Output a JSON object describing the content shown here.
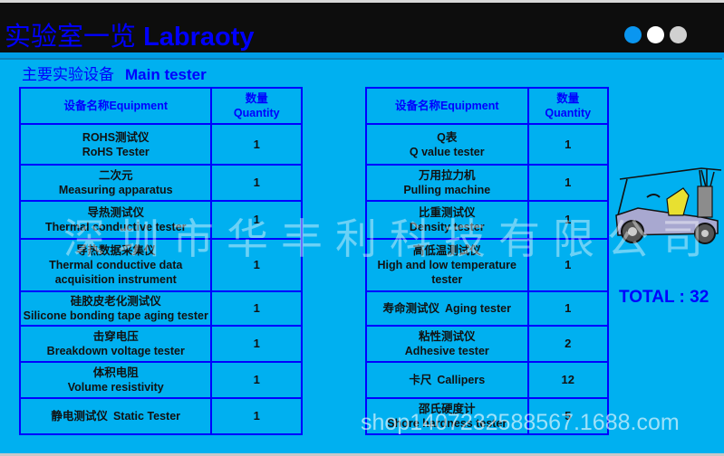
{
  "header": {
    "title_cn": "实验室一览",
    "title_en": "Labraoty",
    "dots": [
      "active",
      "inactive",
      "inactive"
    ]
  },
  "subtitle": {
    "cn": "主要实验设备",
    "en": "Main tester"
  },
  "table_headers": {
    "equipment": "设备名称Equipment",
    "quantity_cn": "数量",
    "quantity_en": "Quantity"
  },
  "left_table": [
    {
      "cn": "ROHS测试仪",
      "en": "RoHS Tester",
      "qty": "1"
    },
    {
      "cn": "二次元",
      "en": "Measuring apparatus",
      "qty": "1"
    },
    {
      "cn": "导热测试仪",
      "en": "Thermal conductive tester",
      "qty": "1"
    },
    {
      "cn": "导热数据采集仪",
      "en": "Thermal conductive data acquisition instrument",
      "qty": "1"
    },
    {
      "cn": "硅胶皮老化测试仪",
      "en": "Silicone bonding tape aging tester",
      "qty": "1"
    },
    {
      "cn": "击穿电压",
      "en": "Breakdown voltage tester",
      "qty": "1"
    },
    {
      "cn": "体积电阻",
      "en": "Volume resistivity",
      "qty": "1"
    },
    {
      "cn": "静电测试仪",
      "en": "Static Tester",
      "qty": "1"
    }
  ],
  "right_table": [
    {
      "cn": "Q表",
      "en": "Q value tester",
      "qty": "1"
    },
    {
      "cn": "万用拉力机",
      "en": "Pulling machine",
      "qty": "1"
    },
    {
      "cn": "比重测试仪",
      "en": "Density tester",
      "qty": "1"
    },
    {
      "cn": "高低温测试仪",
      "en": "High and low temperature tester",
      "qty": "1"
    },
    {
      "cn": "寿命测试仪",
      "en": "Aging tester",
      "qty": "1"
    },
    {
      "cn": "粘性测试仪",
      "en": "Adhesive tester",
      "qty": "2"
    },
    {
      "cn": "卡尺",
      "en": "Callipers",
      "qty": "12"
    },
    {
      "cn": "邵氏硬度计",
      "en": "Shore hardness tester",
      "qty": "5"
    }
  ],
  "total": {
    "label": "TOTAL",
    "separator": ":",
    "value": "32"
  },
  "decoration": {
    "image": "golf-cart-clipart"
  },
  "watermarks": {
    "company": "深圳市华丰利科技有限公司",
    "shop": "shop1407232588567.1688.com"
  },
  "colors": {
    "background": "#00b0f0",
    "header_bg": "#0d0d0d",
    "accent_blue": "#0000ff",
    "dot_active": "#0a96f0"
  }
}
